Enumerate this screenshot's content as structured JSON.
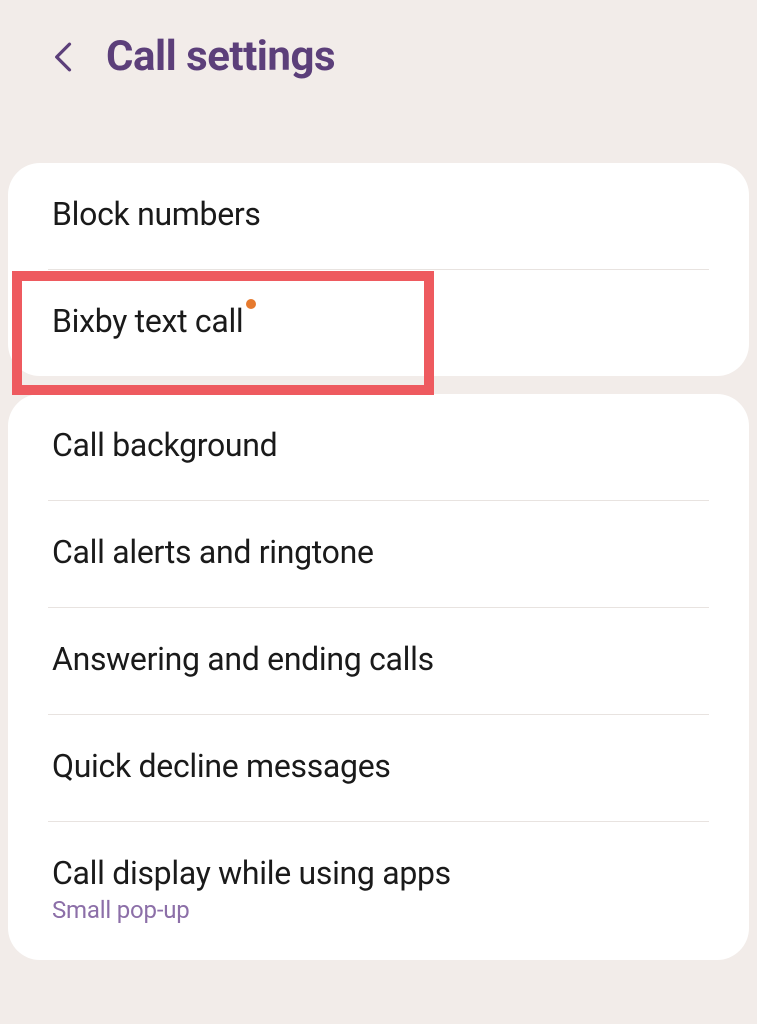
{
  "header": {
    "title": "Call settings"
  },
  "section1": {
    "items": [
      {
        "label": "Block numbers"
      },
      {
        "label": "Bixby text call"
      }
    ]
  },
  "section2": {
    "items": [
      {
        "label": "Call background"
      },
      {
        "label": "Call alerts and ringtone"
      },
      {
        "label": "Answering and ending calls"
      },
      {
        "label": "Quick decline messages"
      },
      {
        "label": "Call display while using apps",
        "subtitle": "Small pop-up"
      }
    ]
  }
}
